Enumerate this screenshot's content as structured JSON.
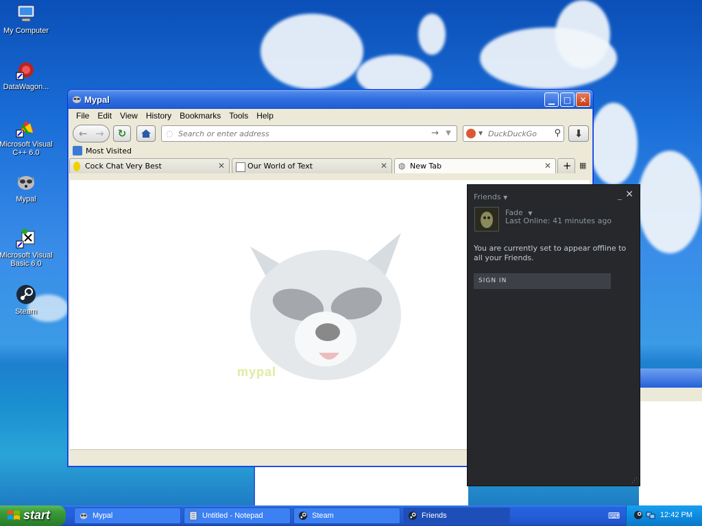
{
  "desktop": {
    "icons": [
      {
        "label": "My Computer"
      },
      {
        "label": "DataWagon..."
      },
      {
        "label_line1": "Microsoft Visual",
        "label_line2": "C++ 6.0"
      },
      {
        "label": "Mypal"
      },
      {
        "label_line1": "Microsoft Visual",
        "label_line2": "Basic 6.0"
      },
      {
        "label": "Steam"
      }
    ]
  },
  "browser": {
    "title": "Mypal",
    "menu": [
      "File",
      "Edit",
      "View",
      "History",
      "Bookmarks",
      "Tools",
      "Help"
    ],
    "address_placeholder": "Search or enter address",
    "search_placeholder": "DuckDuckGo",
    "bookmark": "Most Visited",
    "tabs": [
      {
        "label": "Cock Chat Very Best"
      },
      {
        "label": "Our World of Text"
      },
      {
        "label": "New Tab"
      }
    ],
    "watermark": "mypal"
  },
  "friends": {
    "header": "Friends",
    "user_name": "Fade",
    "user_status": "Last Online: 41 minutes ago",
    "message": "You are currently set to appear offline to all your Friends.",
    "signin_label": "SIGN IN"
  },
  "taskbar": {
    "start_label": "start",
    "tasks": [
      {
        "label": "Mypal"
      },
      {
        "label": "Untitled - Notepad"
      },
      {
        "label": "Steam"
      },
      {
        "label": "Friends"
      }
    ],
    "clock": "12:42 PM"
  },
  "colors": {
    "xp_blue": "#245edb",
    "start_green": "#3c9c3c",
    "steam_bg": "#26282c"
  }
}
